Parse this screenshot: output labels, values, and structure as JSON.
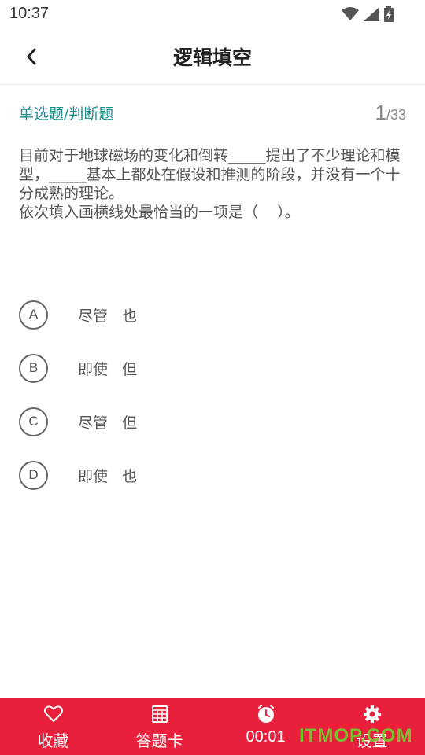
{
  "status_bar": {
    "time": "10:37",
    "icons": [
      "wifi-icon",
      "signal-icon",
      "battery-charging-icon"
    ]
  },
  "header": {
    "title": "逻辑填空",
    "back_icon": "chevron-left-icon"
  },
  "question_meta": {
    "type": "单选题/判断题",
    "current": "1",
    "total": "/33"
  },
  "question": {
    "line1": "目前对于地球磁场的变化和倒转_____提出了不少理论和模型，_____基本上都处在假设和推测的阶段，并没有一个十分成熟的理论。",
    "line2": "依次填入画横线处最恰当的一项是（    ）。"
  },
  "options": [
    {
      "letter": "A",
      "text": "尽管   也"
    },
    {
      "letter": "B",
      "text": "即使   但"
    },
    {
      "letter": "C",
      "text": "尽管   但"
    },
    {
      "letter": "D",
      "text": "即使   也"
    }
  ],
  "bottom_bar": {
    "color": "#e8203c",
    "tabs": [
      {
        "label": "收藏",
        "icon": "heart-icon"
      },
      {
        "label": "答题卡",
        "icon": "grid-card-icon"
      },
      {
        "label": "00:01",
        "icon": "clock-icon"
      },
      {
        "label": "设置",
        "icon": "gear-icon"
      }
    ]
  },
  "watermark": "ITMOP.COM"
}
